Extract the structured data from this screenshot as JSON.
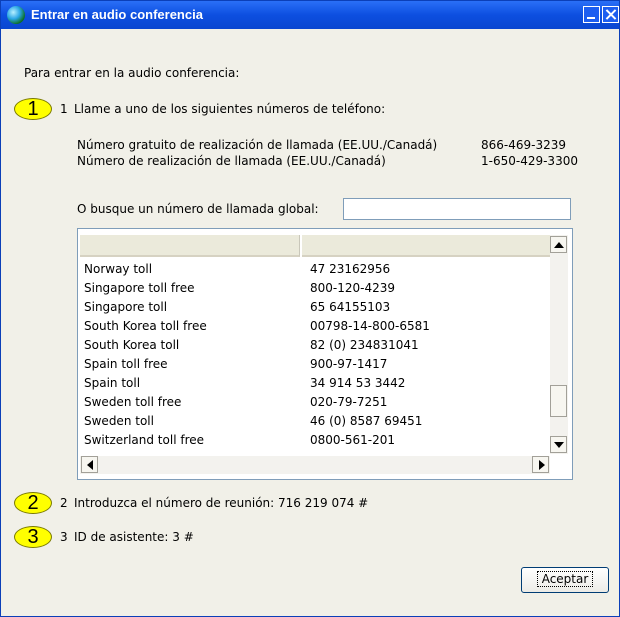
{
  "window": {
    "title": "Entrar en audio conferencia"
  },
  "intro": "Para entrar en la audio conferencia:",
  "callouts": [
    "1",
    "2",
    "3"
  ],
  "steps": {
    "step1_num": "1",
    "step1": "Llame a uno de los siguientes números de teléfono:",
    "step2_num": "2",
    "step2": "Introduzca el número de reunión: 716 219 074  #",
    "step3_num": "3",
    "step3": "ID de asistente: 3 #"
  },
  "phones": [
    {
      "label": "Número gratuito de realización de llamada (EE.UU./Canadá)",
      "number": "866-469-3239"
    },
    {
      "label": "Número de realización de llamada (EE.UU./Canadá)",
      "number": "1-650-429-3300"
    }
  ],
  "search": {
    "label": "O busque un número de llamada global:",
    "value": ""
  },
  "list": {
    "columns": [
      "",
      ""
    ],
    "rows": [
      {
        "country": "Norway toll",
        "number": "47 23162956"
      },
      {
        "country": "Singapore toll free",
        "number": "800-120-4239"
      },
      {
        "country": "Singapore toll",
        "number": "65 64155103"
      },
      {
        "country": "South Korea toll free",
        "number": "00798-14-800-6581"
      },
      {
        "country": "South Korea toll",
        "number": "82 (0) 234831041"
      },
      {
        "country": "Spain toll free",
        "number": "900-97-1417"
      },
      {
        "country": "Spain toll",
        "number": "34 914 53 3442"
      },
      {
        "country": "Sweden toll free",
        "number": "020-79-7251"
      },
      {
        "country": "Sweden toll",
        "number": "46 (0) 8587 69451"
      },
      {
        "country": "Switzerland toll free",
        "number": "0800-561-201"
      }
    ]
  },
  "accept_button": "Aceptar"
}
